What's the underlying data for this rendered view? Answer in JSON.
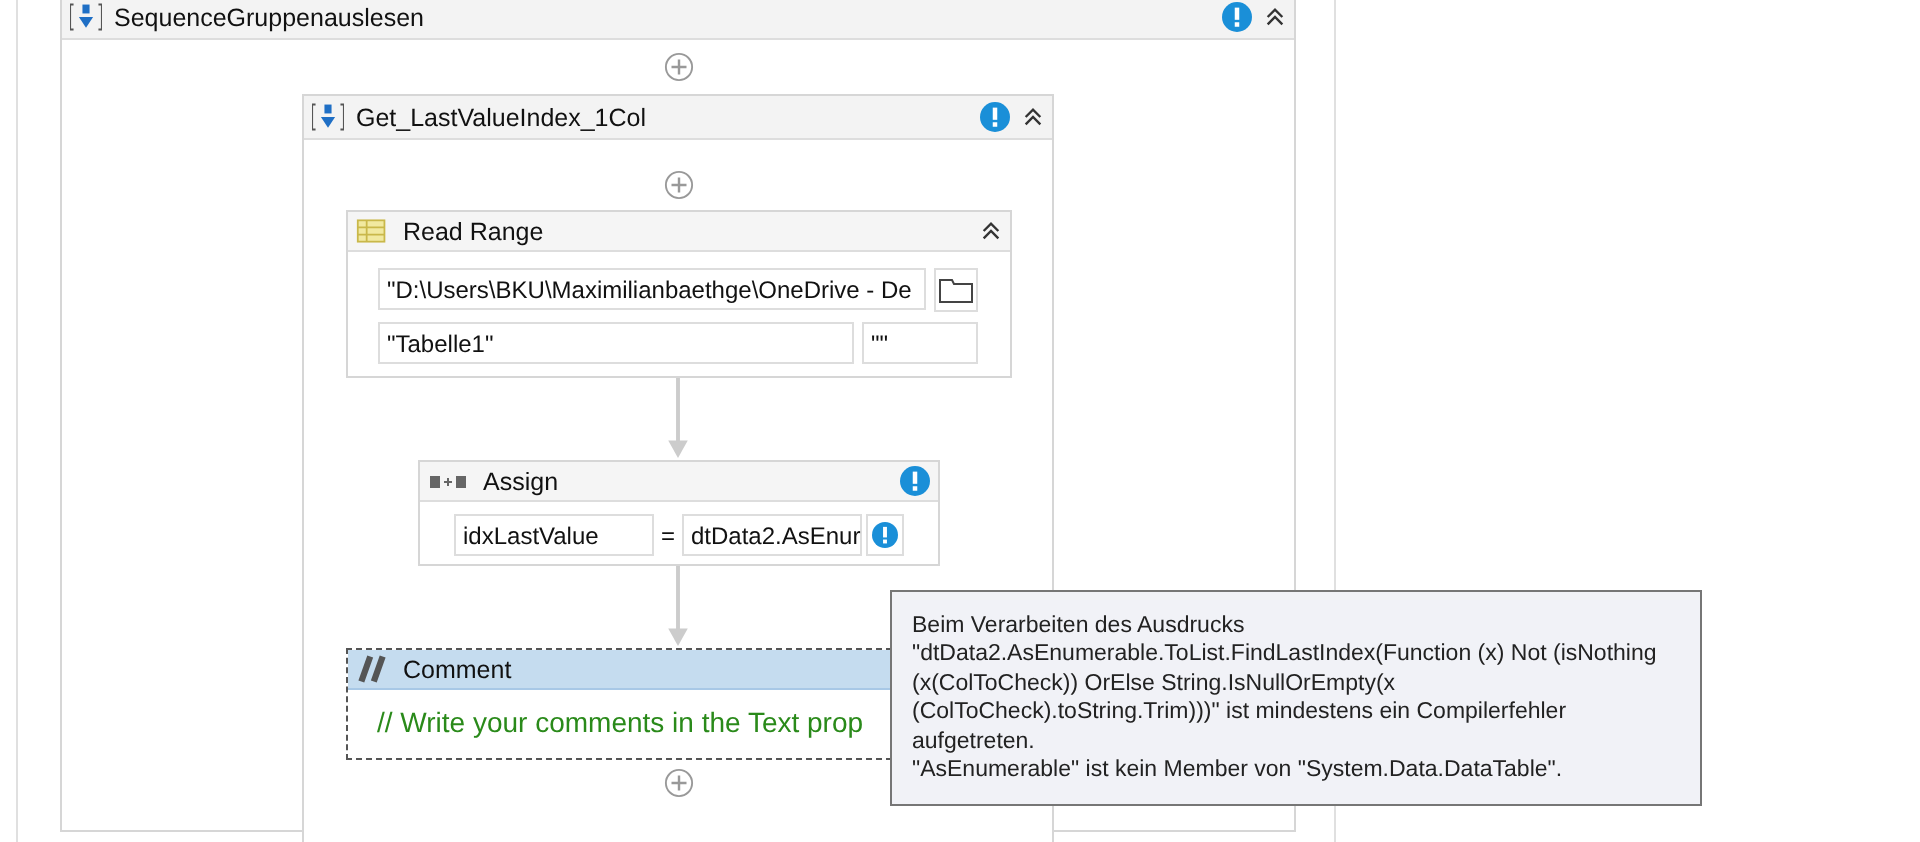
{
  "sequence": {
    "title": "SequenceGruppenauslesen",
    "warning": true,
    "inner_sequence": {
      "title": "Get_LastValueIndex_1Col",
      "warning": true,
      "activities": [
        {
          "kind": "read_range",
          "title": "Read Range",
          "path": "\"D:\\Users\\BKU\\Maximilianbaethge\\OneDrive - De",
          "sheet": "\"Tabelle1\"",
          "range": "\"\""
        },
        {
          "kind": "assign",
          "title": "Assign",
          "warning": true,
          "to": "idxLastValue",
          "operator": "=",
          "value": "dtData2.AsEnur",
          "value_warning": true
        },
        {
          "kind": "comment",
          "title": "Comment",
          "selected": true,
          "text": "// Write your comments in the Text prop"
        }
      ]
    }
  },
  "tooltip": {
    "text": "Beim Verarbeiten des Ausdrucks\n\"dtData2.AsEnumerable.ToList.FindLastIndex(Function (x) Not (isNothing\n(x(ColToCheck)) OrElse String.IsNullOrEmpty(x\n(ColToCheck).toString.Trim)))\" ist mindestens ein Compilerfehler\naufgetreten.\n\"AsEnumerable\" ist kein Member von \"System.Data.DataTable\"."
  }
}
